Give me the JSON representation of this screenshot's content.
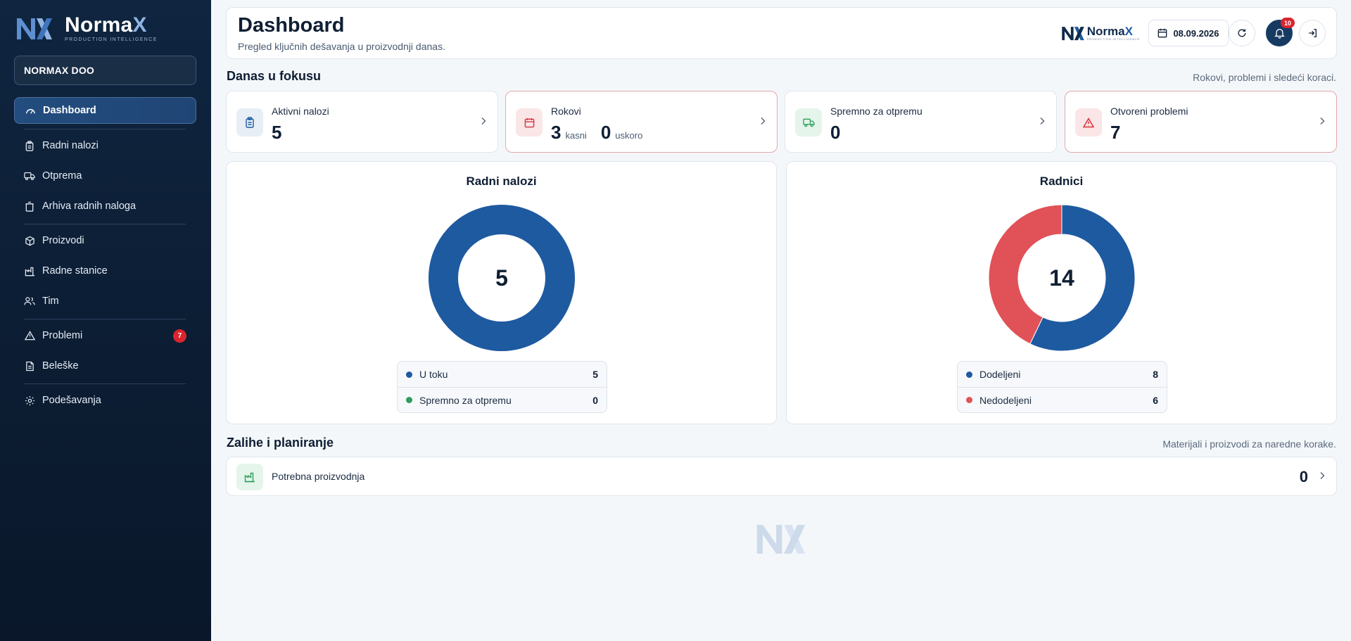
{
  "brand": {
    "name_part1": "Norma",
    "name_part2": "X",
    "tagline": "PRODUCTION INTELLIGENCE"
  },
  "sidebar": {
    "company": "NORMAX DOO",
    "items": [
      {
        "label": "Dashboard",
        "icon": "dashboard-gauge-icon",
        "active": true
      },
      {
        "label": "Radni nalozi",
        "icon": "clipboard-icon"
      },
      {
        "label": "Otprema",
        "icon": "truck-icon"
      },
      {
        "label": "Arhiva radnih naloga",
        "icon": "archive-icon"
      },
      {
        "label": "Proizvodi",
        "icon": "box-icon"
      },
      {
        "label": "Radne stanice",
        "icon": "factory-icon"
      },
      {
        "label": "Tim",
        "icon": "users-icon"
      },
      {
        "label": "Problemi",
        "icon": "warning-icon",
        "badge": "7"
      },
      {
        "label": "Beleške",
        "icon": "notes-icon"
      },
      {
        "label": "Podešavanja",
        "icon": "gear-icon"
      }
    ]
  },
  "header": {
    "title": "Dashboard",
    "subtitle": "Pregled ključnih dešavanja u proizvodnji danas.",
    "date": "08.09.2026",
    "notification_count": "10"
  },
  "focus": {
    "title": "Danas u fokusu",
    "hint": "Rokovi, problemi i sledeći koraci.",
    "cards": [
      {
        "label": "Aktivni nalozi",
        "value": "5"
      },
      {
        "label": "Rokovi",
        "late_value": "3",
        "late_label": "kasni",
        "soon_value": "0",
        "soon_label": "uskoro"
      },
      {
        "label": "Spremno za otpremu",
        "value": "0"
      },
      {
        "label": "Otvoreni problemi",
        "value": "7"
      }
    ]
  },
  "chart_data": [
    {
      "type": "pie",
      "title": "Radni nalozi",
      "total": "5",
      "categories": [
        "U toku",
        "Spremno za otpremu"
      ],
      "values": [
        5,
        0
      ],
      "colors": [
        "#1e5aa0",
        "#2e9e5a"
      ]
    },
    {
      "type": "pie",
      "title": "Radnici",
      "total": "14",
      "categories": [
        "Dodeljeni",
        "Nedodeljeni"
      ],
      "values": [
        8,
        6
      ],
      "colors": [
        "#1e5aa0",
        "#e05258"
      ]
    }
  ],
  "stock": {
    "title": "Zalihe i planiranje",
    "hint": "Materijali i proizvodi za naredne korake.",
    "item_label": "Potrebna proizvodnja",
    "item_value": "0"
  },
  "colors": {
    "accent": "#1e5aa0",
    "danger": "#e05258",
    "success": "#2e9e5a",
    "sidebar_bg": "#0f2540"
  }
}
